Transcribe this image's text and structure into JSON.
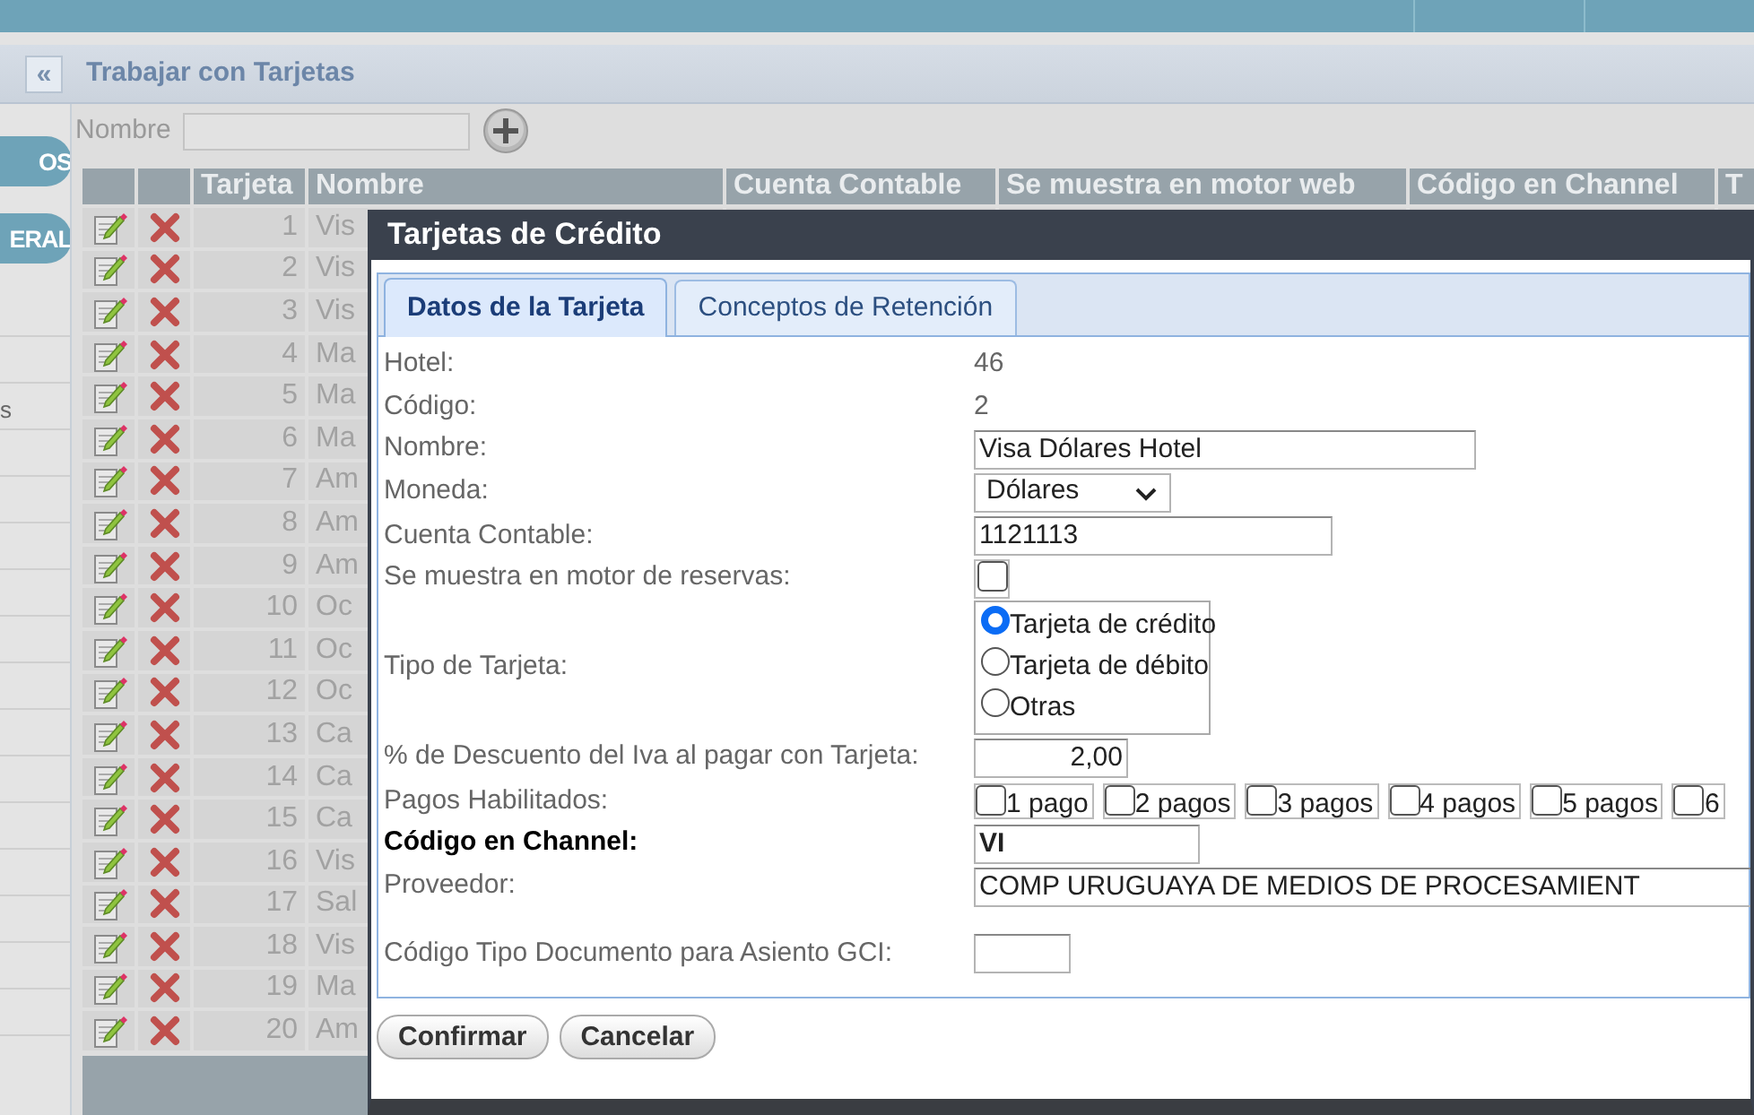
{
  "sidebar": {
    "items": [
      {
        "kind": "pill",
        "label": "OS"
      },
      {
        "kind": "pill",
        "label": "ERAL"
      },
      {
        "kind": "row"
      },
      {
        "kind": "row"
      },
      {
        "kind": "row",
        "label": "s"
      },
      {
        "kind": "row"
      },
      {
        "kind": "row"
      },
      {
        "kind": "row"
      },
      {
        "kind": "row"
      },
      {
        "kind": "row"
      },
      {
        "kind": "row"
      },
      {
        "kind": "row"
      },
      {
        "kind": "row"
      },
      {
        "kind": "row"
      },
      {
        "kind": "row"
      },
      {
        "kind": "row"
      },
      {
        "kind": "row"
      },
      {
        "kind": "row"
      }
    ]
  },
  "page": {
    "collapse_button": "«",
    "title": "Trabajar con Tarjetas"
  },
  "filter": {
    "label": "Nombre"
  },
  "table": {
    "columns": [
      "Tarjeta",
      "Nombre",
      "Cuenta Contable",
      "Se muestra en motor web",
      "Código en Channel",
      "T"
    ],
    "rows": [
      {
        "number": "1",
        "name": "Vis"
      },
      {
        "number": "2",
        "name": "Vis"
      },
      {
        "number": "3",
        "name": "Vis"
      },
      {
        "number": "4",
        "name": "Ma"
      },
      {
        "number": "5",
        "name": "Ma"
      },
      {
        "number": "6",
        "name": "Ma"
      },
      {
        "number": "7",
        "name": "Am"
      },
      {
        "number": "8",
        "name": "Am"
      },
      {
        "number": "9",
        "name": "Am"
      },
      {
        "number": "10",
        "name": "Oc"
      },
      {
        "number": "11",
        "name": "Oc"
      },
      {
        "number": "12",
        "name": "Oc"
      },
      {
        "number": "13",
        "name": "Ca"
      },
      {
        "number": "14",
        "name": "Ca"
      },
      {
        "number": "15",
        "name": "Ca"
      },
      {
        "number": "16",
        "name": "Vis"
      },
      {
        "number": "17",
        "name": "Sal"
      },
      {
        "number": "18",
        "name": "Vis"
      },
      {
        "number": "19",
        "name": "Ma"
      },
      {
        "number": "20",
        "name": "Am"
      }
    ]
  },
  "dialog": {
    "title": "Tarjetas de Crédito",
    "tabs": [
      {
        "label": "Datos de la Tarjeta",
        "selected": true
      },
      {
        "label": "Conceptos de Retención",
        "selected": false
      }
    ],
    "fields": [
      {
        "kind": "text",
        "label": "Hotel:",
        "value": "46",
        "bold": false
      },
      {
        "kind": "text",
        "label": "Código:",
        "value": "2",
        "bold": false
      },
      {
        "kind": "input",
        "label": "Nombre:",
        "value": "Visa Dólares Hotel",
        "bold": false
      },
      {
        "kind": "select",
        "label": "Moneda:",
        "value": "Dólares",
        "bold": false
      },
      {
        "kind": "input",
        "label": "Cuenta Contable:",
        "value": "1121113",
        "bold": false
      },
      {
        "kind": "checkbox",
        "label": "Se muestra en motor de reservas:",
        "checked": false,
        "bold": false
      },
      {
        "kind": "radios",
        "label": "Tipo de Tarjeta:",
        "bold": false,
        "options": [
          {
            "label": "Tarjeta de crédito",
            "selected": true
          },
          {
            "label": "Tarjeta de débito",
            "selected": false
          },
          {
            "label": "Otras",
            "selected": false
          }
        ]
      },
      {
        "kind": "number",
        "label": "% de Descuento del Iva al pagar con Tarjeta:",
        "value": "2,00",
        "bold": false
      },
      {
        "kind": "checkgroup",
        "label": "Pagos Habilitados:",
        "bold": false,
        "options": [
          {
            "label": "1 pago",
            "checked": false
          },
          {
            "label": "2 pagos",
            "checked": false
          },
          {
            "label": "3 pagos",
            "checked": false
          },
          {
            "label": "4 pagos",
            "checked": false
          },
          {
            "label": "5 pagos",
            "checked": false
          },
          {
            "label": "6",
            "checked": false
          }
        ]
      },
      {
        "kind": "input",
        "label": "Código en Channel:",
        "value": "VI",
        "bold": true
      },
      {
        "kind": "input",
        "label": "Proveedor:",
        "value": "COMP URUGUAYA DE MEDIOS DE PROCESAMIENT",
        "bold": false
      },
      {
        "kind": "input",
        "label": "Código Tipo Documento para Asiento GCI:",
        "bold": false
      }
    ],
    "buttons": [
      "Confirmar",
      "Cancelar"
    ]
  }
}
